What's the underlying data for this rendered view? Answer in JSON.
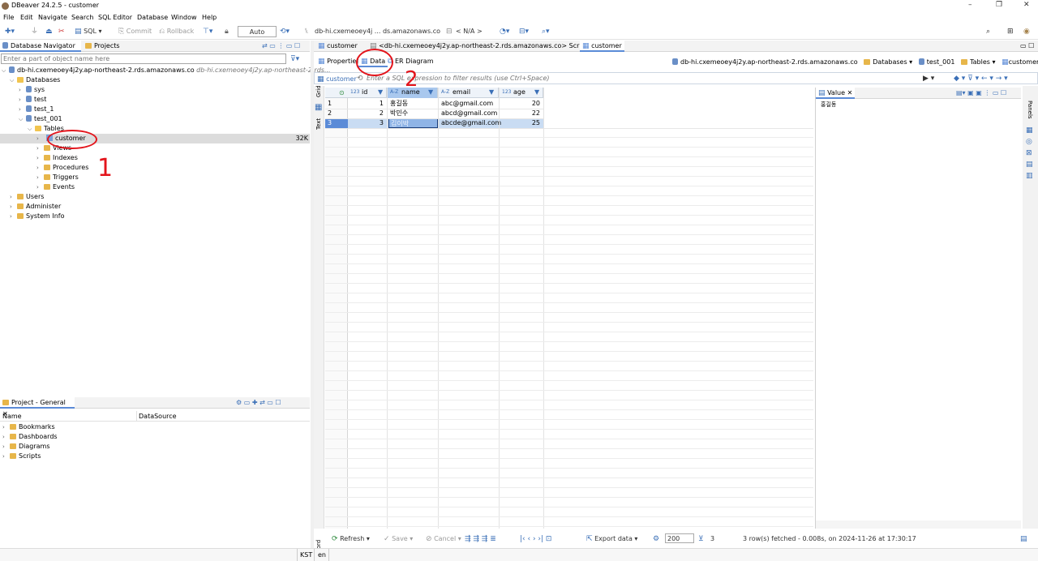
{
  "window": {
    "title": "DBeaver 24.2.5 - customer",
    "controls": [
      "–",
      "❐",
      "✕"
    ]
  },
  "menu": [
    "File",
    "Edit",
    "Navigate",
    "Search",
    "SQL Editor",
    "Database",
    "Window",
    "Help"
  ],
  "toolbar": {
    "sql_label": "SQL",
    "commit_label": "Commit",
    "rollback_label": "Rollback",
    "mode_value": "Auto",
    "connection": "db-hi.cxemeoey4j ... ds.amazonaws.co",
    "schema": "< N/A >"
  },
  "navigator": {
    "tabs": [
      "Database Navigator",
      "Projects"
    ],
    "filter_placeholder": "Enter a part of object name here",
    "connection": "db-hi.cxemeoey4j2y.ap-northeast-2.rds.amazonaws.co",
    "connection_suffix": "db-hi.cxemeoey4j2y.ap-northeast-2.rds...",
    "databases_label": "Databases",
    "schemas": [
      "sys",
      "test",
      "test_1",
      "test_001"
    ],
    "tables_label": "Tables",
    "table_selected": "customer",
    "table_size": "32K",
    "views_label": "Views",
    "folders": [
      "Indexes",
      "Procedures",
      "Triggers",
      "Events"
    ],
    "root_items": [
      "Users",
      "Administer",
      "System Info"
    ]
  },
  "project": {
    "tab": "Project - General",
    "col_name": "Name",
    "col_datasource": "DataSource",
    "items": [
      "Bookmarks",
      "Dashboards",
      "Diagrams",
      "Scripts"
    ]
  },
  "editor": {
    "tabs": [
      "customer",
      "<db-hi.cxemeoey4j2y.ap-northeast-2.rds.amazonaws.co> Script",
      "customer"
    ],
    "subtabs": [
      "Properties",
      "Data",
      "ER Diagram"
    ],
    "breadcrumb": [
      "db-hi.cxemeoey4j2y.ap-northeast-2.rds.amazonaws.co",
      "Databases",
      "test_001",
      "Tables",
      "customer"
    ],
    "filter_table": "customer",
    "filter_placeholder": "Enter a SQL expression to filter results (use Ctrl+Space)",
    "side_labels": [
      "Grid",
      "Text",
      "Record"
    ],
    "panels_label": "Panels"
  },
  "grid": {
    "columns": [
      {
        "type": "123",
        "name": "id"
      },
      {
        "type": "A-Z",
        "name": "name"
      },
      {
        "type": "A-Z",
        "name": "email"
      },
      {
        "type": "123",
        "name": "age"
      }
    ],
    "rows": [
      {
        "num": "1",
        "id": "1",
        "name": "홍길동",
        "email": "abc@gmail.com",
        "age": "20"
      },
      {
        "num": "2",
        "id": "2",
        "name": "박민수",
        "email": "abcd@gmail.com",
        "age": "22"
      },
      {
        "num": "3",
        "id": "3",
        "name": "김이박",
        "email": "abcde@gmail.com",
        "age": "25"
      }
    ]
  },
  "value_panel": {
    "title": "Value",
    "content": "홍길동"
  },
  "bottom_bar": {
    "refresh": "Refresh",
    "save": "Save",
    "cancel": "Cancel",
    "export": "Export data",
    "fetch_size": "200",
    "row_count": "3",
    "status": "3 row(s) fetched - 0.008s, on 2024-11-26 at 17:30:17"
  },
  "statusbar": {
    "tz": "KST",
    "locale": "en"
  },
  "annotations": {
    "one": "1",
    "two": "2",
    "color": "#e3141b"
  }
}
